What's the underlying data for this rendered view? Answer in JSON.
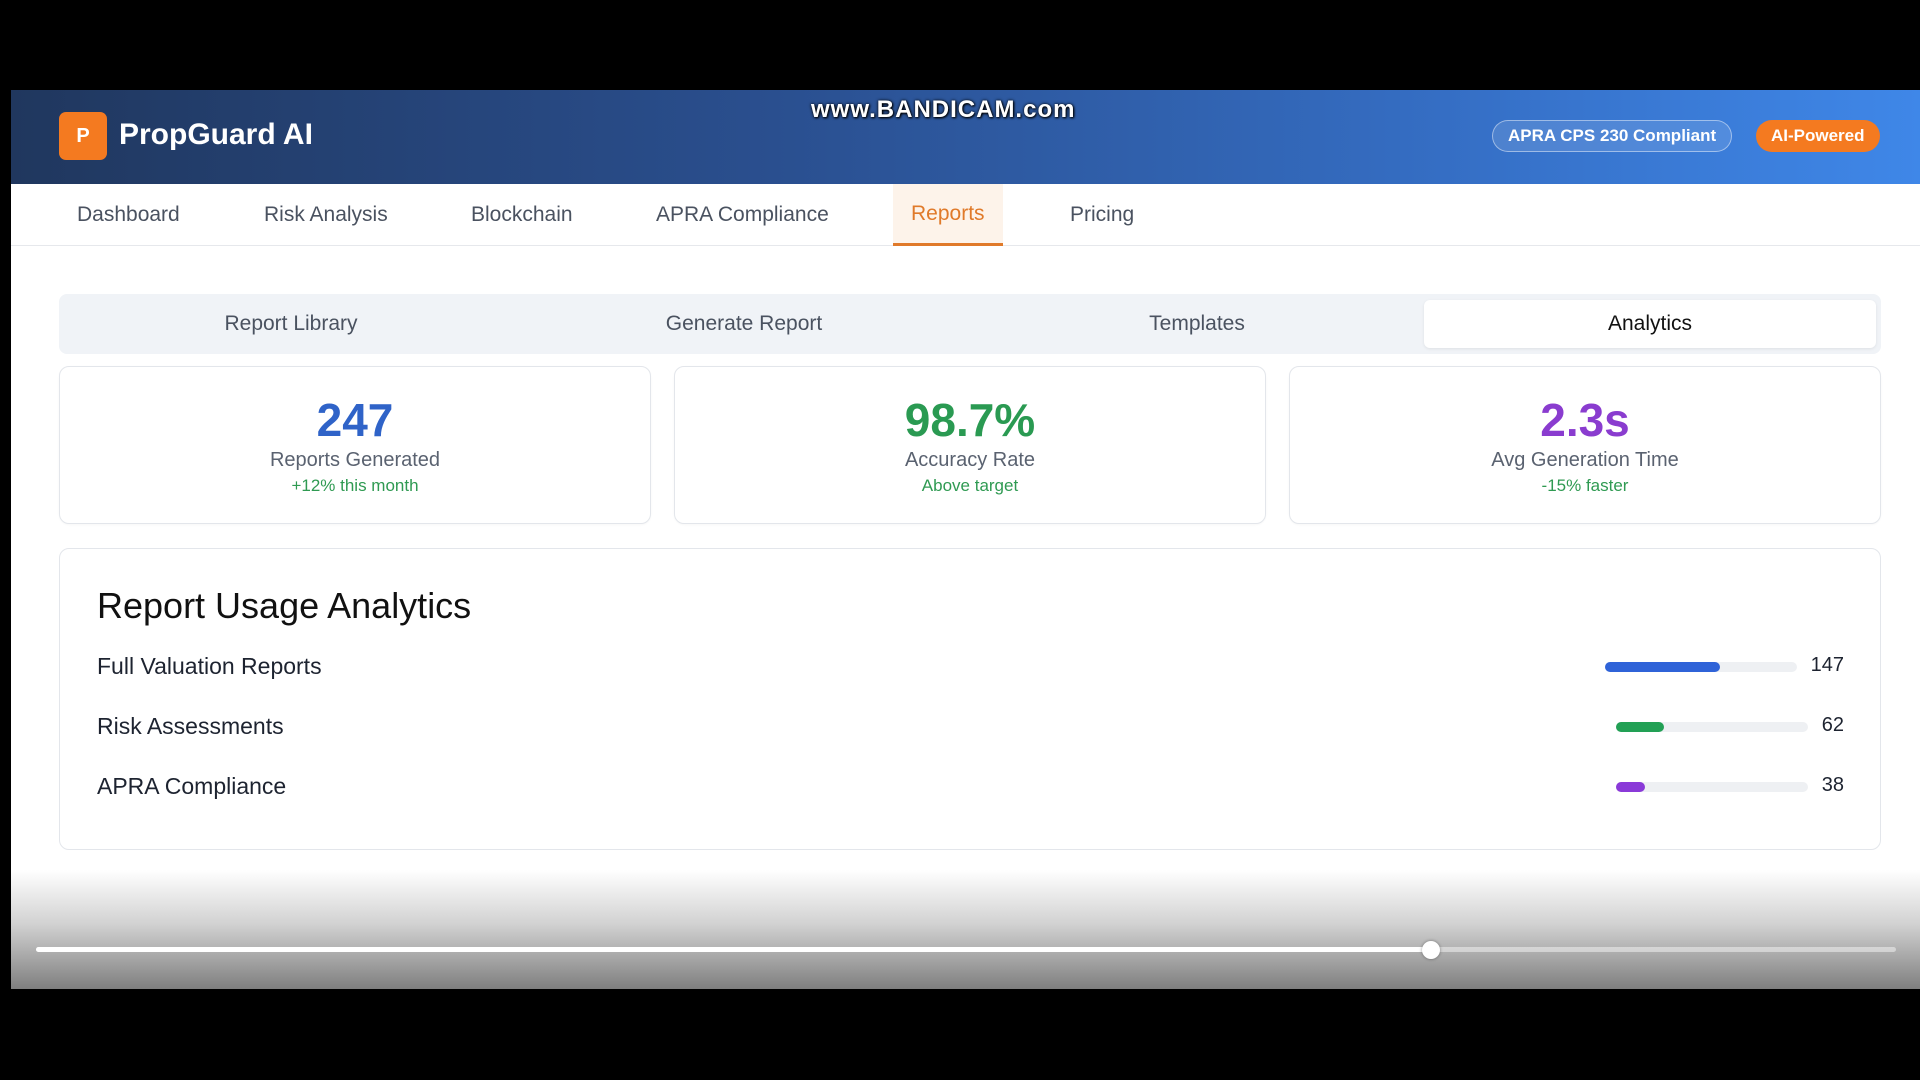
{
  "app": {
    "logo_letter": "P",
    "title": "PropGuard AI",
    "watermark": "www.BANDICAM.com",
    "badge_compliant": "APRA CPS 230 Compliant",
    "badge_ai": "AI-Powered",
    "accent_color": "#f47a20"
  },
  "nav": {
    "items": [
      {
        "label": "Dashboard"
      },
      {
        "label": "Risk Analysis"
      },
      {
        "label": "Blockchain"
      },
      {
        "label": "APRA Compliance"
      },
      {
        "label": "Reports",
        "active": true
      },
      {
        "label": "Pricing"
      }
    ]
  },
  "subtabs": {
    "items": [
      {
        "label": "Report Library"
      },
      {
        "label": "Generate Report"
      },
      {
        "label": "Templates"
      },
      {
        "label": "Analytics",
        "active": true
      }
    ]
  },
  "stats": [
    {
      "value": "247",
      "label": "Reports Generated",
      "sub": "+12% this month",
      "color": "#2f63c8"
    },
    {
      "value": "98.7%",
      "label": "Accuracy Rate",
      "sub": "Above target",
      "color": "#2a9a52"
    },
    {
      "value": "2.3s",
      "label": "Avg Generation Time",
      "sub": "-15% faster",
      "color": "#8a3ccf"
    }
  ],
  "usage": {
    "title": "Report Usage Analytics",
    "rows": [
      {
        "label": "Full Valuation Reports",
        "count": "147",
        "fill": 0.6,
        "color": "#2f63d8"
      },
      {
        "label": "Risk Assessments",
        "count": "62",
        "fill": 0.25,
        "color": "#22a055"
      },
      {
        "label": "APRA Compliance",
        "count": "38",
        "fill": 0.15,
        "color": "#8a3ad8"
      }
    ]
  },
  "player": {
    "progress": 0.75
  }
}
